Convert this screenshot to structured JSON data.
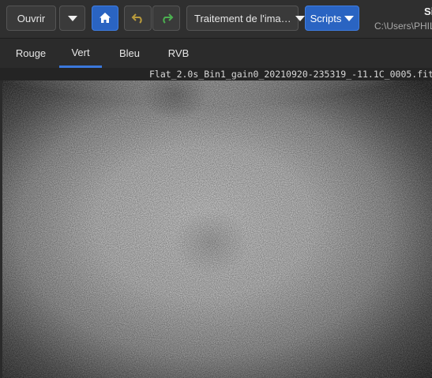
{
  "toolbar": {
    "open_label": "Ouvrir",
    "processing_label": "Traitement de l'ima…",
    "scripts_label": "Scripts",
    "app_title": "Si",
    "path": "C:\\Users\\PHIL"
  },
  "tabs": [
    {
      "label": "Rouge",
      "active": false
    },
    {
      "label": "Vert",
      "active": true
    },
    {
      "label": "Bleu",
      "active": false
    },
    {
      "label": "RVB",
      "active": false
    }
  ],
  "image": {
    "filename": "Flat_2.0s_Bin1_gain0_20210920-235319_-11.1C_0005.fit"
  },
  "colors": {
    "accent": "#2a64c2",
    "undo_icon": "#b89a3c",
    "redo_icon": "#4caf50"
  }
}
